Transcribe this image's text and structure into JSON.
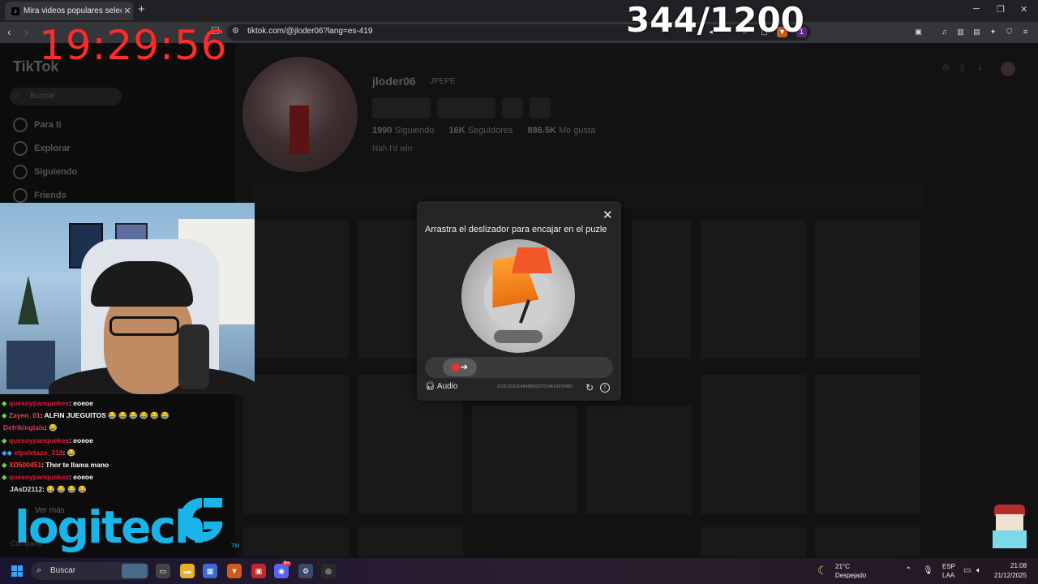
{
  "browser": {
    "tab_title": "Mira videos populares seleccion",
    "url": "tiktok.com/@jloder06?lang=es-419",
    "new_tab": "+",
    "extension_badge": "1"
  },
  "overlay": {
    "clock": "19:29:56",
    "counter": "344/1200"
  },
  "tiktok": {
    "logo": "TikTok",
    "search_placeholder": "Buscar",
    "nav": [
      "Para ti",
      "Explorar",
      "Siguiendo",
      "Friends"
    ],
    "profile": {
      "username": "jloder06",
      "nickname": "JPEPE",
      "following_count": "1990",
      "following_label": "Siguiendo",
      "followers_count": "16K",
      "followers_label": "Seguidores",
      "likes_count": "886.5K",
      "likes_label": "Me gusta",
      "bio": "Nah I'd win"
    }
  },
  "captcha": {
    "title": "Arrastra el deslizador para encajar en el puzle",
    "audio_label": "Audio",
    "code": "20251221000849B00297524F01F58983"
  },
  "chat": [
    {
      "user": "quesoypanquekes",
      "msg": ": eoeoe",
      "emotes": ""
    },
    {
      "user": "Zayen_01",
      "msg": ": ALFIN JUEGUITOS",
      "emotes": "😂 😂 😂 😂 😂 😂"
    },
    {
      "user": "Defrikinglais",
      "msg": ":",
      "emotes": "😂"
    },
    {
      "user": "quesoypanquekes",
      "msg": ": eoeoe",
      "emotes": ""
    },
    {
      "user": "elpaletazo_318",
      "msg": ":",
      "emotes": "😂"
    },
    {
      "user": "XD500451",
      "msg": ": Thor te llama mano",
      "emotes": ""
    },
    {
      "user": "quesoypanquekes",
      "msg": ": eoeoe",
      "emotes": ""
    },
    {
      "user": "JAsD2112",
      "msg": ":",
      "emotes": "😂 😂 😂 😂"
    }
  ],
  "sponsor": {
    "brand": "logitech",
    "see_more": "Ver más",
    "company": "Company",
    "tm": "TM"
  },
  "taskbar": {
    "search": "Buscar",
    "temp": "21°C",
    "condition": "Despejado",
    "lang": "ESP",
    "layout": "LAA",
    "time": "21:08",
    "date": "21/12/2025",
    "discord_badge": "9+"
  },
  "colors": {
    "accent_red": "#ff2a2a",
    "logitech_blue": "#19b4ea",
    "modal_bg": "#252525"
  }
}
